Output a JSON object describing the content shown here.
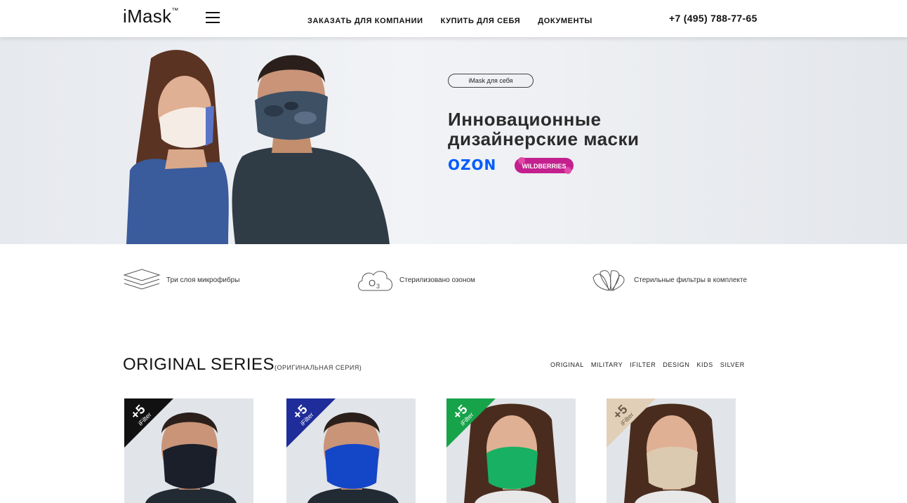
{
  "header": {
    "logo": "iMask",
    "logo_mark": "™",
    "menu_icon": "hamburger-icon",
    "nav": [
      "ЗАКАЗАТЬ ДЛЯ КОМПАНИИ",
      "КУПИТЬ ДЛЯ СЕБЯ",
      "ДОКУМЕНТЫ"
    ],
    "phone": "+7 (495) 788-77-65"
  },
  "hero": {
    "pill": "iMask для себя",
    "title": "Инновационные дизайнерские маски",
    "ozon": "OZON",
    "wildberries": "WILDBERRIES"
  },
  "features": [
    {
      "icon": "layers-icon",
      "label": "Три слоя микрофибры"
    },
    {
      "icon": "ozone-cloud-icon",
      "label": "Стерилизовано озоном"
    },
    {
      "icon": "filters-fan-icon",
      "label": "Стерильные фильтры в комплекте"
    }
  ],
  "series": {
    "title": "ORIGINAL SERIES",
    "subtitle": "(ОРИГИНАЛЬНАЯ СЕРИЯ)",
    "filters": [
      "ORIGINAL",
      "MILITARY",
      "IFILTER",
      "DESIGN",
      "KIDS",
      "SILVER"
    ]
  },
  "products": [
    {
      "badge_big": "+5",
      "badge_small": "iFilter",
      "badge_color": "#111111",
      "mask_color": "#1b1f2a",
      "person": "man"
    },
    {
      "badge_big": "+5",
      "badge_small": "iFilter",
      "badge_color": "#1f2d9a",
      "mask_color": "#1446c8",
      "person": "man"
    },
    {
      "badge_big": "+5",
      "badge_small": "iFilter",
      "badge_color": "#16a34a",
      "mask_color": "#18b062",
      "person": "woman"
    },
    {
      "badge_big": "+5",
      "badge_small": "iFilter",
      "badge_color": "#e2cfb8",
      "mask_color": "#dccab0",
      "person": "woman"
    }
  ]
}
